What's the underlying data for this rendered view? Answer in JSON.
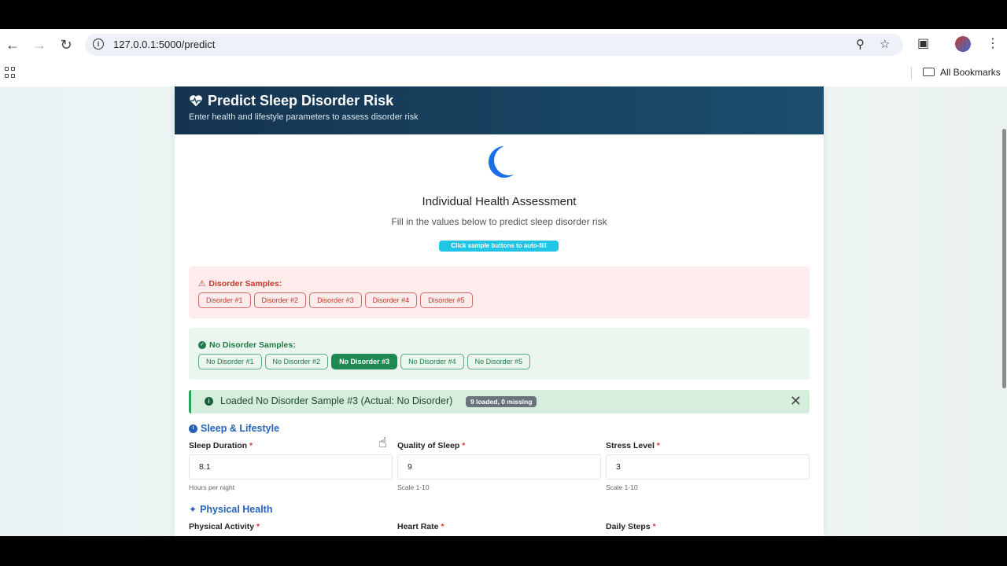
{
  "browser": {
    "url": "127.0.0.1:5000/predict",
    "bookmarks_label": "All Bookmarks"
  },
  "header": {
    "title": "Predict Sleep Disorder Risk",
    "subtitle": "Enter health and lifestyle parameters to assess disorder risk"
  },
  "assessment": {
    "title": "Individual Health Assessment",
    "subtitle": "Fill in the values below to predict sleep disorder risk",
    "hint": "Click sample buttons to auto-fill"
  },
  "disorder_samples": {
    "title": "Disorder Samples:",
    "buttons": [
      "Disorder #1",
      "Disorder #2",
      "Disorder #3",
      "Disorder #4",
      "Disorder #5"
    ]
  },
  "no_disorder_samples": {
    "title": "No Disorder Samples:",
    "buttons": [
      "No Disorder #1",
      "No Disorder #2",
      "No Disorder #3",
      "No Disorder #4",
      "No Disorder #5"
    ],
    "active_index": 2
  },
  "alert": {
    "message": "Loaded No Disorder Sample #3 (Actual: No Disorder)",
    "badge": "9 loaded, 0 missing"
  },
  "sleep_section": {
    "title": "Sleep & Lifestyle",
    "fields": [
      {
        "label": "Sleep Duration",
        "value": "8.1",
        "help": "Hours per night"
      },
      {
        "label": "Quality of Sleep",
        "value": "9",
        "help": "Scale 1-10"
      },
      {
        "label": "Stress Level",
        "value": "3",
        "help": "Scale 1-10"
      }
    ]
  },
  "physical_section": {
    "title": "Physical Health",
    "fields": [
      {
        "label": "Physical Activity"
      },
      {
        "label": "Heart Rate"
      },
      {
        "label": "Daily Steps"
      }
    ]
  },
  "colors": {
    "header_bg": "#15344f",
    "accent_blue": "#2563b8",
    "danger": "#c0392b",
    "success": "#1e8a52",
    "info_badge": "#21c4e2"
  }
}
